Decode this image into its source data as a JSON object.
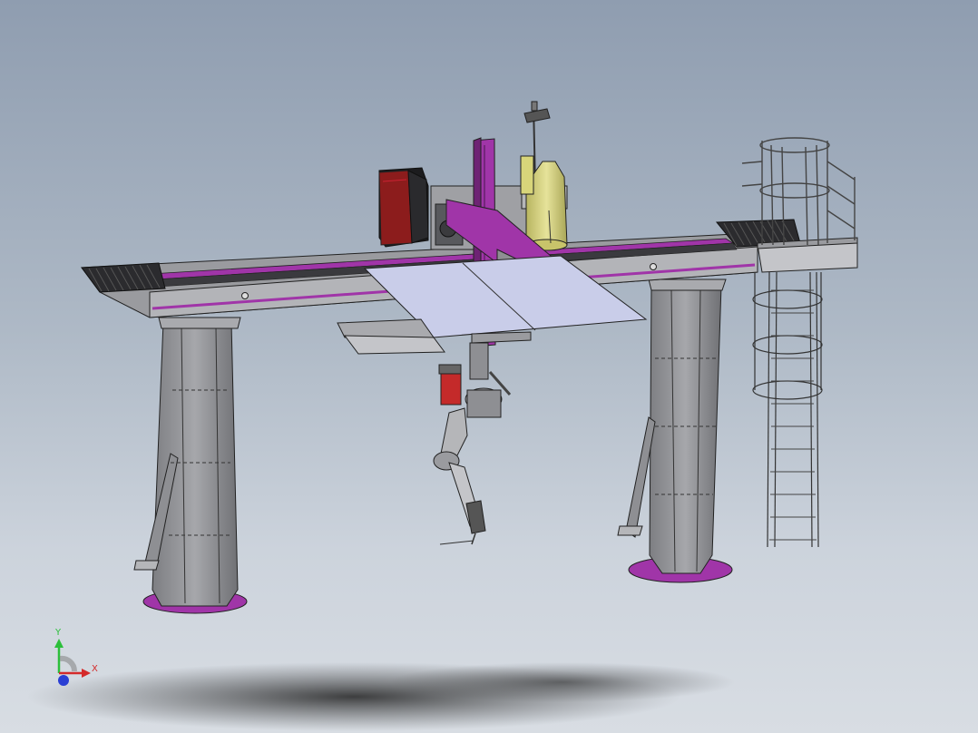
{
  "triad": {
    "x_label": "X",
    "y_label": "Y",
    "x_color": "#d42a2a",
    "y_color": "#2bbf3a",
    "z_color": "#2a3fd4"
  },
  "colors": {
    "accent": "#a035a8",
    "steel": "#8e8f93",
    "steel_light": "#b5b6b9",
    "panel": "#c9cde9",
    "cabinet": "#8c1c1c",
    "wire_drum": "#d8d57a",
    "motor": "#c42a2a"
  }
}
